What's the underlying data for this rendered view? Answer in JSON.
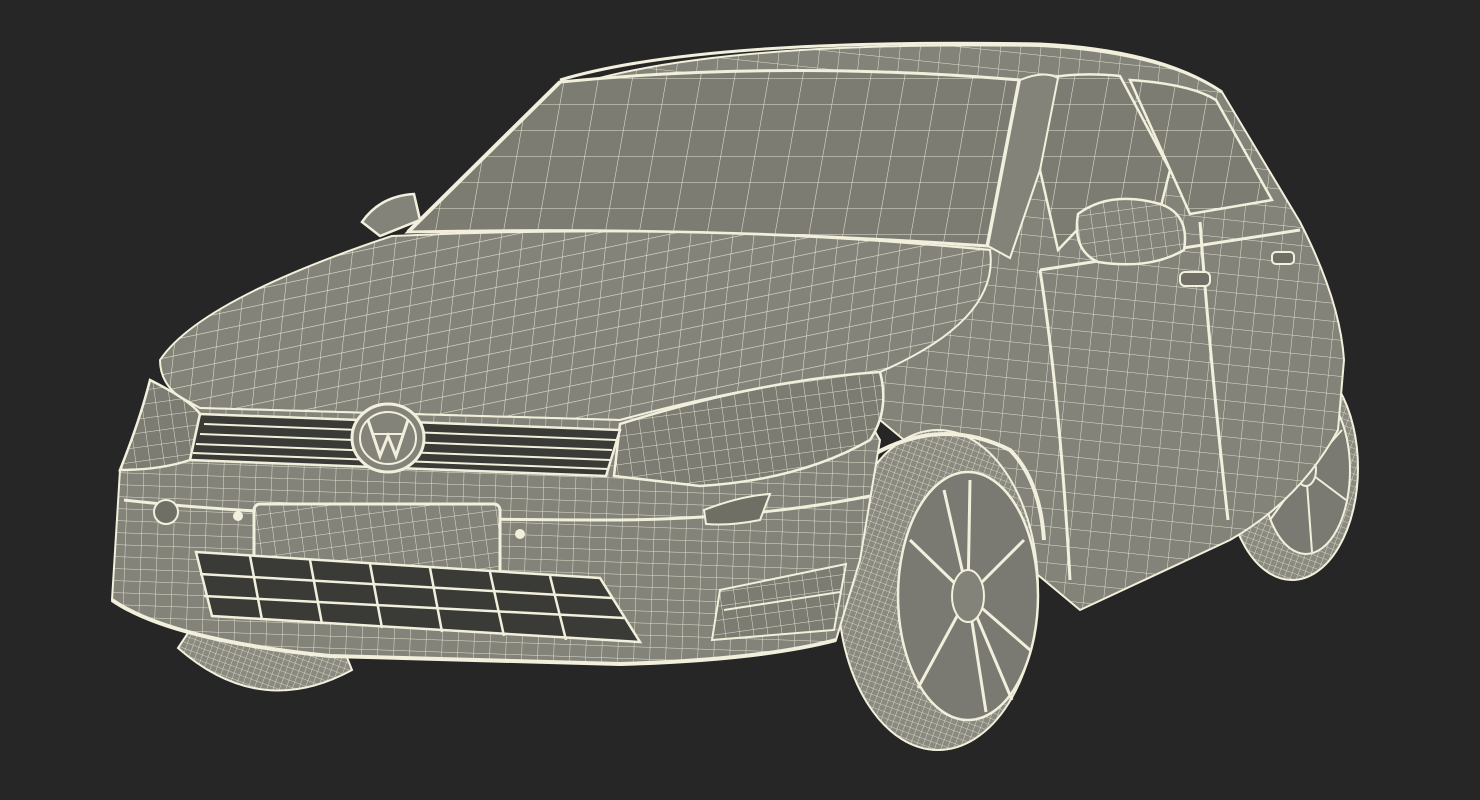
{
  "scene": {
    "subject": "hatchback-car-wireframe",
    "view": "front-three-quarter",
    "colors": {
      "background": "#262626",
      "shell": "#83837a",
      "shell_dark": "#6f6f66",
      "glass": "#7c7c73",
      "wire": "#f2f0dc",
      "wire_dim": "#d9d7c4",
      "grille": "#3a3a36",
      "tire": "#8a8a80"
    },
    "wireframe": {
      "density": "high"
    }
  }
}
